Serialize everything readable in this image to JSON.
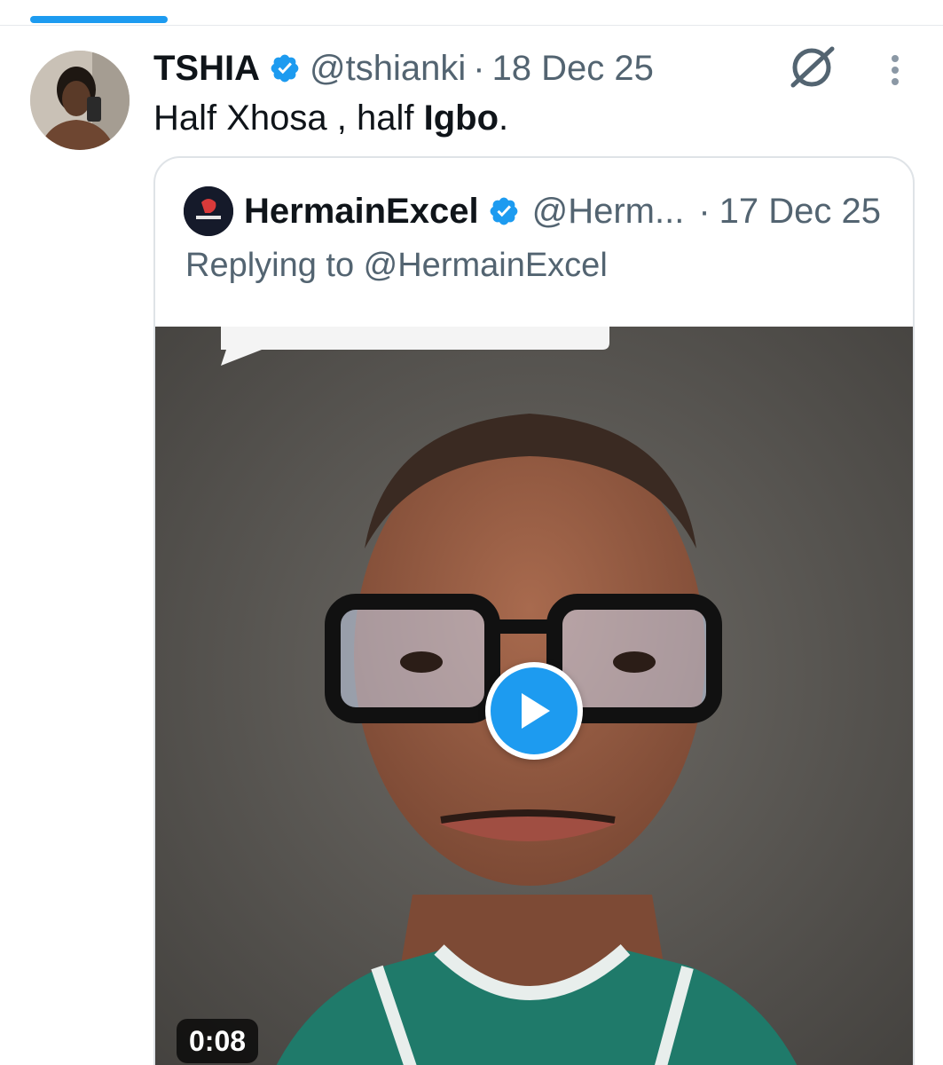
{
  "tweet": {
    "display_name": "TSHIA",
    "handle": "@tshianki",
    "separator": "·",
    "date": "18 Dec 25",
    "text_part1": "Half Xhosa , half ",
    "text_bold": "Igbo",
    "text_part2": "."
  },
  "quoted_tweet": {
    "display_name": "HermainExcel",
    "handle": "@Herm...",
    "separator": "·",
    "date": "17 Dec 25",
    "replying_to": "Replying to @HermainExcel",
    "video_duration": "0:08"
  },
  "colors": {
    "accent": "#1d9bf0",
    "secondary_text": "#536471",
    "primary_text": "#0f1419",
    "border": "#dfe3e7"
  },
  "icons": {
    "verified": "verified-badge-icon",
    "grok": "grok-icon",
    "more": "more-vertical-icon",
    "play": "play-icon"
  }
}
